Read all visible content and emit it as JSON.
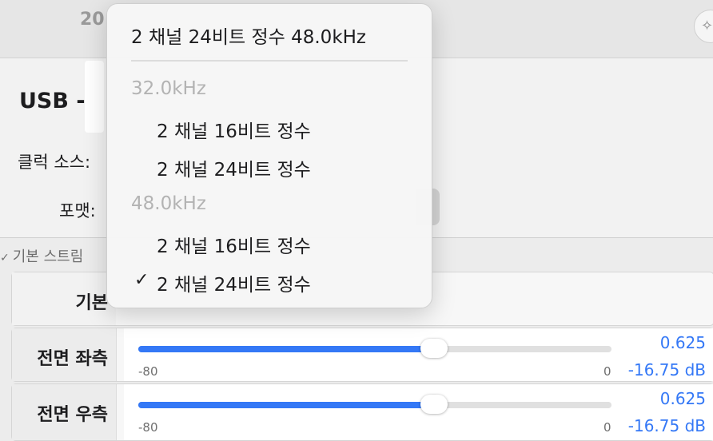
{
  "window": {
    "top_number": "20",
    "sparkle_icon": "sparkle-icon"
  },
  "device": {
    "title": "USB -",
    "clock_source_label": "클럭 소스:",
    "format_label": "포맷:"
  },
  "section": {
    "header": "기본 스트림",
    "header_icon": "chevron-down-icon"
  },
  "rows": [
    {
      "label": "기본"
    },
    {
      "label": "전면 좌측",
      "slider_level": 0.625,
      "min_label": "-80",
      "max_label": "0",
      "value": "0.625",
      "db": "-16.75 dB"
    },
    {
      "label": "전면 우측",
      "slider_level": 0.625,
      "min_label": "-80",
      "max_label": "0",
      "value": "0.625",
      "db": "-16.75 dB"
    }
  ],
  "format_menu": {
    "current": "2 채널 24비트 정수 48.0kHz",
    "groups": [
      {
        "header": "32.0kHz",
        "items": [
          "2 채널 16비트 정수",
          "2 채널 24비트 정수"
        ]
      },
      {
        "header": "48.0kHz",
        "items": [
          "2 채널 16비트 정수",
          "2 채널 24비트 정수"
        ]
      }
    ],
    "checked_icon": "checkmark-icon"
  },
  "colors": {
    "accent": "#3478f6",
    "disabled_text": "#b3b3b3"
  }
}
